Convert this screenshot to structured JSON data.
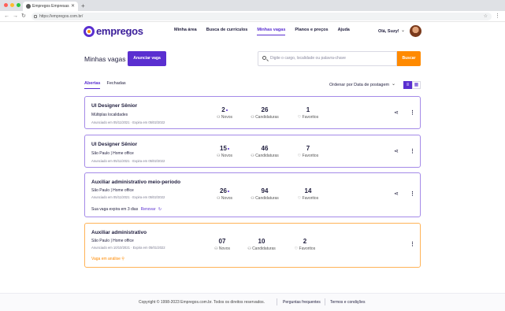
{
  "browser": {
    "tab_title": "Empregos Empresas",
    "url": "https://empregos.com.br/",
    "colors": {
      "red": "#ff5f57",
      "yellow": "#febc2e",
      "green": "#28c840"
    }
  },
  "header": {
    "logo": "empregos",
    "nav": [
      "Minha área",
      "Busca de currículos",
      "Minhas vagas",
      "Planos e preços",
      "Ajuda"
    ],
    "active_nav": "Minhas vagas",
    "greeting": "Olá, Suzy!"
  },
  "page": {
    "title": "Minhas vagas",
    "post_button": "Anunciar vaga",
    "search_placeholder": "Digite o cargo, localidade ou palavra-chave",
    "search_button": "Buscar",
    "tabs": [
      "Abertas",
      "Fechadas"
    ],
    "sort_label": "Ordenar por Data de postagem"
  },
  "jobs": [
    {
      "title": "UI Designer Sênior",
      "location": "Múltiplas localidades",
      "dates": "Anunciado em 05/11/2021 · Expira em 05/02/2022",
      "new": "2",
      "applications": "26",
      "favorites": "1",
      "labels": {
        "new": "Novos",
        "applications": "Candidaturas",
        "favorites": "Favoritos"
      }
    },
    {
      "title": "UI Designer Sênior",
      "location": "São Paulo | Home office",
      "dates": "Anunciado em 05/11/2021 · Expira em 05/02/2022",
      "new": "15",
      "applications": "46",
      "favorites": "7",
      "labels": {
        "new": "Novos",
        "applications": "Candidaturas",
        "favorites": "Favoritos"
      }
    },
    {
      "title": "Auxiliar administrativo meio-período",
      "location": "São Paulo | Home office",
      "dates": "Anunciado em 05/11/2021 · Expira em 05/02/2022",
      "new": "26",
      "applications": "94",
      "favorites": "14",
      "expire_note": "Sua vaga expira em 3 dias",
      "renew": "Renovar",
      "labels": {
        "new": "Novos",
        "applications": "Candidaturas",
        "favorites": "Favoritos"
      }
    },
    {
      "title": "Auxiliar administrativo",
      "location": "São Paulo | Home office",
      "dates": "Anunciado em 10/10/2021 · Expira em 05/01/2022",
      "new": "07",
      "applications": "10",
      "favorites": "2",
      "status": "Vaga em análise",
      "labels": {
        "new": "Novos",
        "applications": "Candidaturas",
        "favorites": "Favoritos"
      }
    }
  ],
  "footer": {
    "copyright": "Copyright © 1998-2023 Empregos.com.br. Todos os direitos reservados.",
    "faq": "Perguntas frequentes",
    "terms": "Termos e condições"
  },
  "colors": {
    "primary": "#5a2fd0",
    "accent": "#ff8a00",
    "card_border": "#a48ae8",
    "card_border_pending": "#ffb357"
  }
}
